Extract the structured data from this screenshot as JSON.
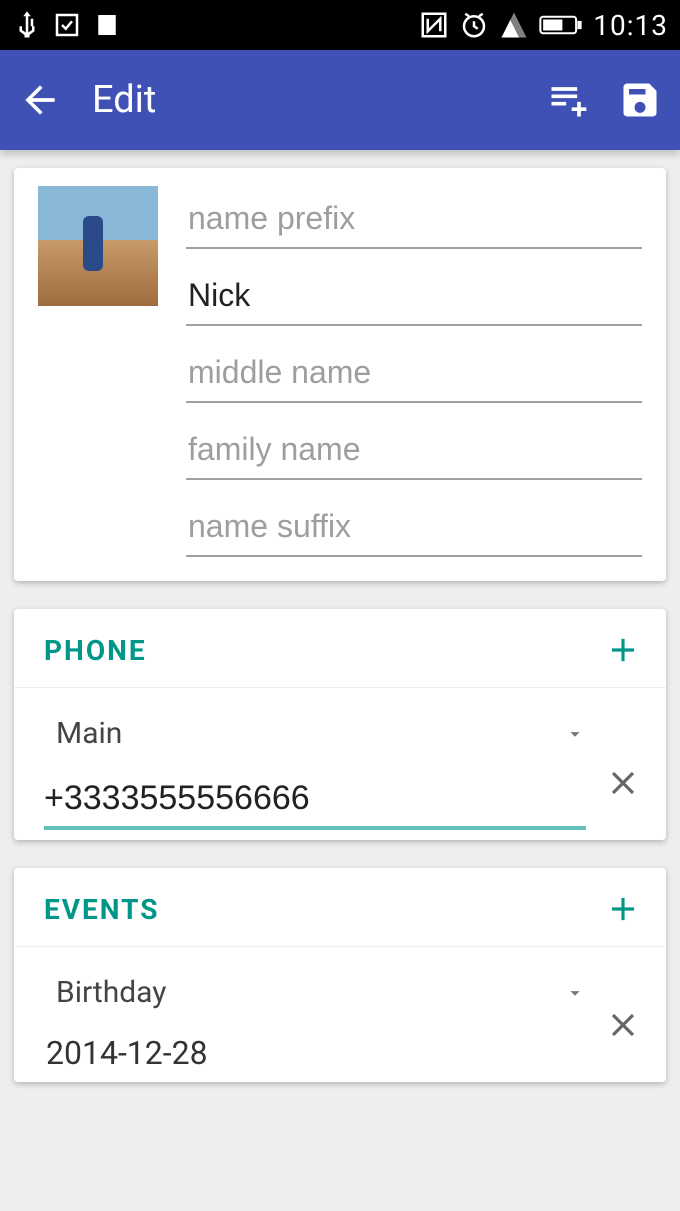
{
  "status": {
    "time": "10:13"
  },
  "appbar": {
    "title": "Edit"
  },
  "name": {
    "prefix_placeholder": "name prefix",
    "first_value": "Nick",
    "middle_placeholder": "middle name",
    "family_placeholder": "family name",
    "suffix_placeholder": "name suffix"
  },
  "phone": {
    "header": "PHONE",
    "type_label": "Main",
    "number": "+3333555556666"
  },
  "events": {
    "header": "EVENTS",
    "type_label": "Birthday",
    "date": "2014-12-28"
  }
}
